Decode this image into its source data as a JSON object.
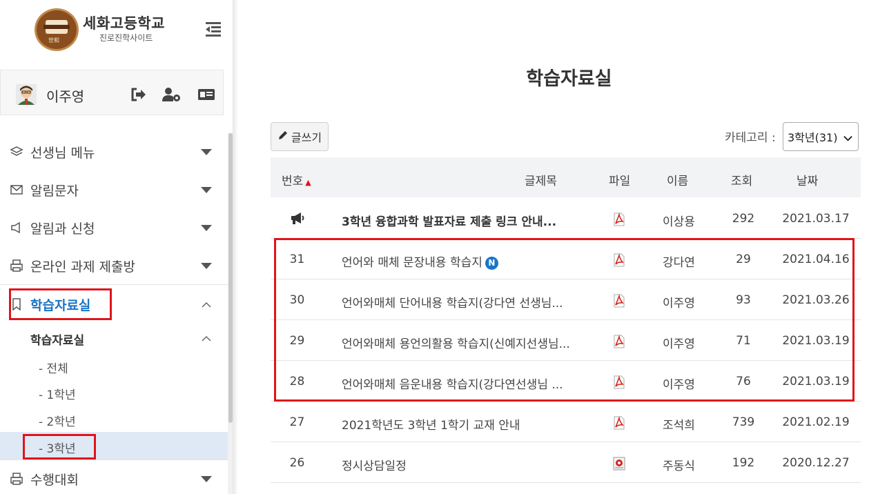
{
  "header": {
    "school_name": "세화고등학교",
    "school_sub": "진로진학사이트",
    "logo_text": "世和"
  },
  "user": {
    "name": "이주영"
  },
  "sidebar": {
    "items": [
      {
        "label": "선생님 메뉴",
        "icon": "layers-icon"
      },
      {
        "label": "알림문자",
        "icon": "envelope-icon"
      },
      {
        "label": "알림과 신청",
        "icon": "megaphone-icon"
      },
      {
        "label": "온라인 과제 제출방",
        "icon": "printer-icon"
      },
      {
        "label": "학습자료실",
        "icon": "bookmark-icon"
      },
      {
        "label": "수행대회",
        "icon": "printer-icon"
      }
    ],
    "submenu_title": "학습자료실",
    "subitems": [
      "- 전체",
      "- 1학년",
      "- 2학년",
      "- 3학년"
    ]
  },
  "main": {
    "title": "학습자료실",
    "write_button": "글쓰기",
    "category_label": "카테고리 :",
    "category_selected": "3학년(31)",
    "columns": {
      "num": "번호",
      "title": "글제목",
      "file": "파일",
      "name": "이름",
      "views": "조회",
      "date": "날짜"
    },
    "rows": [
      {
        "num": "",
        "notice": true,
        "title": "3학년 융합과학 발표자료 제출 링크 안내...",
        "file": "pdf",
        "name": "이상용",
        "views": "292",
        "date": "2021.03.17"
      },
      {
        "num": "31",
        "title": "언어와 매체 문장내용 학습지",
        "new": "N",
        "file": "pdf",
        "name": "강다연",
        "views": "29",
        "date": "2021.04.16"
      },
      {
        "num": "30",
        "title": "언어와매체 단어내용 학습지(강다연 선생님...",
        "file": "pdf",
        "name": "이주영",
        "views": "93",
        "date": "2021.03.26"
      },
      {
        "num": "29",
        "title": "언어와매체 용언의활용 학습지(신예지선생님...",
        "file": "pdf",
        "name": "이주영",
        "views": "71",
        "date": "2021.03.19"
      },
      {
        "num": "28",
        "title": "언어와매체 음운내용 학습지(강다연선생님 ...",
        "file": "pdf",
        "name": "이주영",
        "views": "76",
        "date": "2021.03.19"
      },
      {
        "num": "27",
        "title": "2021학년도 3학년 1학기 교재 안내",
        "file": "pdf",
        "name": "조석희",
        "views": "739",
        "date": "2021.02.19"
      },
      {
        "num": "26",
        "title": "정시상담일정",
        "file": "image",
        "name": "주동식",
        "views": "192",
        "date": "2020.12.27"
      }
    ]
  },
  "colors": {
    "highlight_red": "#e0131b",
    "active_blue": "#1a73c4",
    "active_row_bg": "#dfe9f5",
    "pdf_red": "#d9241c"
  }
}
